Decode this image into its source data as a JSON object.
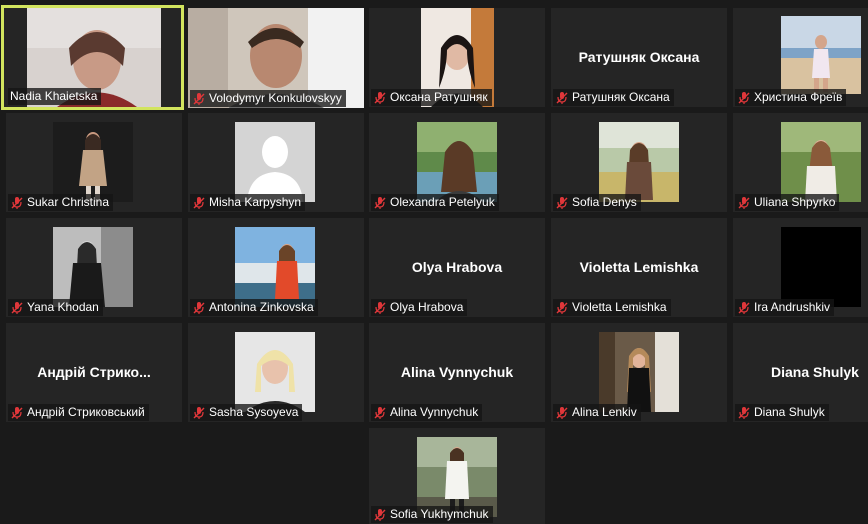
{
  "colors": {
    "active_border": "#d2e45e",
    "muted_icon": "#e0373a",
    "tile_bg": "#252525",
    "app_bg": "#1a1a1a"
  },
  "participants": [
    {
      "name": "Nadia Khaietska",
      "muted": false,
      "video": true,
      "active": true
    },
    {
      "name": "Volodymyr Konkulovskyy",
      "muted": true,
      "video": true
    },
    {
      "name": "Оксана Ратушняк",
      "muted": true,
      "video": true
    },
    {
      "name": "Ратушняк Оксана",
      "display_name": "Ратушняк Оксана",
      "muted": true,
      "video": false
    },
    {
      "name": "Христина Фреїв",
      "muted": true,
      "video": true
    },
    {
      "name": "Sukar Christina",
      "muted": true,
      "video": true
    },
    {
      "name": "Misha Karpyshyn",
      "muted": true,
      "video": true,
      "avatar": "default-avatar-icon"
    },
    {
      "name": "Olexandra Petelyuk",
      "muted": true,
      "video": true
    },
    {
      "name": "Sofia Denys",
      "muted": true,
      "video": true
    },
    {
      "name": "Uliana Shpyrko",
      "muted": true,
      "video": true
    },
    {
      "name": "Yana Khodan",
      "muted": true,
      "video": true
    },
    {
      "name": "Antonina Zinkovska",
      "muted": true,
      "video": true
    },
    {
      "name": "Olya Hrabova",
      "display_name": "Olya Hrabova",
      "muted": true,
      "video": false
    },
    {
      "name": "Violetta Lemishka",
      "display_name": "Violetta Lemishka",
      "muted": true,
      "video": false
    },
    {
      "name": "Ira Andrushkiv",
      "muted": true,
      "video": true
    },
    {
      "name": "Андрій Стриковський",
      "display_name": "Андрій  Стрико...",
      "muted": true,
      "video": false
    },
    {
      "name": "Sasha Sysoyeva",
      "muted": true,
      "video": true
    },
    {
      "name": "Alina Vynnychuk",
      "display_name": "Alina Vynnychuk",
      "muted": true,
      "video": false
    },
    {
      "name": "Alina Lenkiv",
      "muted": true,
      "video": true
    },
    {
      "name": "Diana Shulyk",
      "display_name": "Diana Shulyk",
      "muted": true,
      "video": false
    },
    {
      "name": "Sofia Yukhymchuk",
      "muted": true,
      "video": true
    }
  ]
}
